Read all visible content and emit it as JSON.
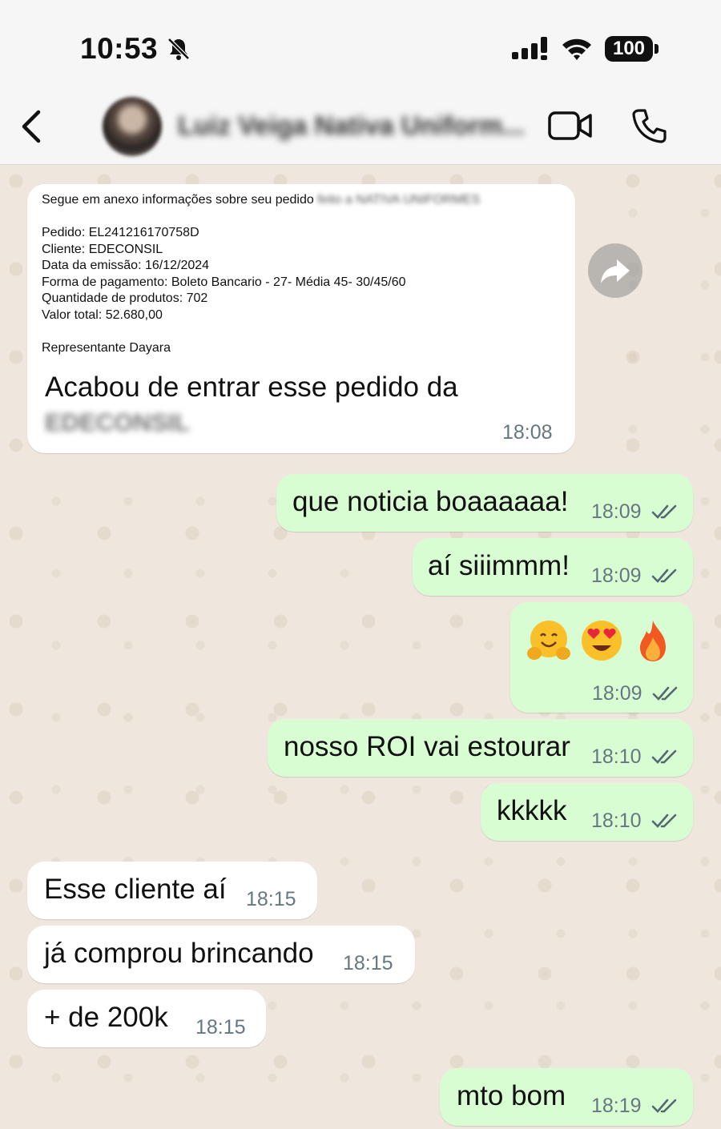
{
  "status_bar": {
    "time": "10:53",
    "battery": "100"
  },
  "header": {
    "contact_name": "Luiz Veiga Nativa Uniform..."
  },
  "messages": {
    "m1": {
      "lines": [
        "Segue em anexo informações sobre seu pedido",
        "Pedido: EL241216170758D",
        "Cliente: EDECONSIL",
        "Data da emissão: 16/12/2024",
        "Forma de pagamento: Boleto Bancario - 27- Média 45- 30/45/60",
        "Quantidade de produtos: 702",
        "Valor total: 52.680,00",
        "Representante Dayara"
      ],
      "line1_blurred": "feito a NATIVA UNIFORMES",
      "text": "Acabou de entrar esse pedido da",
      "text_blurred": "EDECONSIL",
      "time": "18:08"
    },
    "m2": {
      "text": "que noticia boaaaaaa!",
      "time": "18:09"
    },
    "m3": {
      "text": "aí siiimmm!",
      "time": "18:09"
    },
    "m4": {
      "time": "18:09",
      "emojis": [
        "hugging-face",
        "heart-eyes-face",
        "fire"
      ]
    },
    "m5": {
      "text": "nosso ROI vai estourar",
      "time": "18:10"
    },
    "m6": {
      "text": "kkkkk",
      "time": "18:10"
    },
    "m7": {
      "text": "Esse cliente aí",
      "time": "18:15"
    },
    "m8": {
      "text": "já comprou brincando",
      "time": "18:15"
    },
    "m9": {
      "text": "+ de 200k",
      "time": "18:15"
    },
    "m10": {
      "text": "mto bom",
      "time": "18:19"
    }
  },
  "colors": {
    "incoming": "#ffffff",
    "outgoing": "#d9fdd3",
    "read_ticks": "#53686f",
    "background": "#efe7dd"
  }
}
